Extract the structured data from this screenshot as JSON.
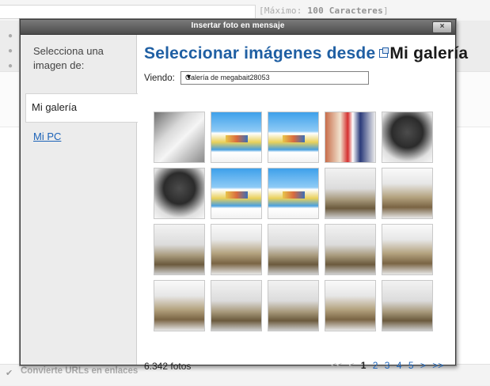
{
  "background": {
    "max_chars_prefix": "[Máximo:",
    "max_chars_value": "100 Caracteres",
    "max_chars_suffix": "]",
    "convert_urls_label": "Convierte URLs en enlaces",
    "convert_urls_checked": true
  },
  "modal": {
    "title": "Insertar foto en mensaje",
    "close_label": "×",
    "sidebar": {
      "heading": "Selecciona una imagen de:",
      "items": [
        {
          "label": "Mi galería",
          "active": true
        },
        {
          "label": "Mi PC",
          "active": false
        }
      ]
    },
    "main": {
      "title": "Seleccionar imágenes desde",
      "title_source": "Mi galería",
      "viewing_label": "Viendo:",
      "gallery_selected": "Galería de megabait28053",
      "photos_count": "6.342 fotos",
      "pager": {
        "first": "<<",
        "prev": "<",
        "pages": [
          "1",
          "2",
          "3",
          "4",
          "5"
        ],
        "current": "1",
        "next": ">",
        "last": ">>"
      }
    }
  },
  "thumbnails": [
    {
      "kind": "white"
    },
    {
      "kind": "poster"
    },
    {
      "kind": "poster"
    },
    {
      "kind": "collage"
    },
    {
      "kind": "dark"
    },
    {
      "kind": "dark"
    },
    {
      "kind": "poster"
    },
    {
      "kind": "poster"
    },
    {
      "kind": "diorama"
    },
    {
      "kind": "diorama2"
    },
    {
      "kind": "diorama"
    },
    {
      "kind": "diorama2"
    },
    {
      "kind": "diorama"
    },
    {
      "kind": "diorama"
    },
    {
      "kind": "diorama2"
    },
    {
      "kind": "diorama2"
    },
    {
      "kind": "diorama"
    },
    {
      "kind": "diorama"
    },
    {
      "kind": "diorama2"
    },
    {
      "kind": "diorama"
    }
  ]
}
